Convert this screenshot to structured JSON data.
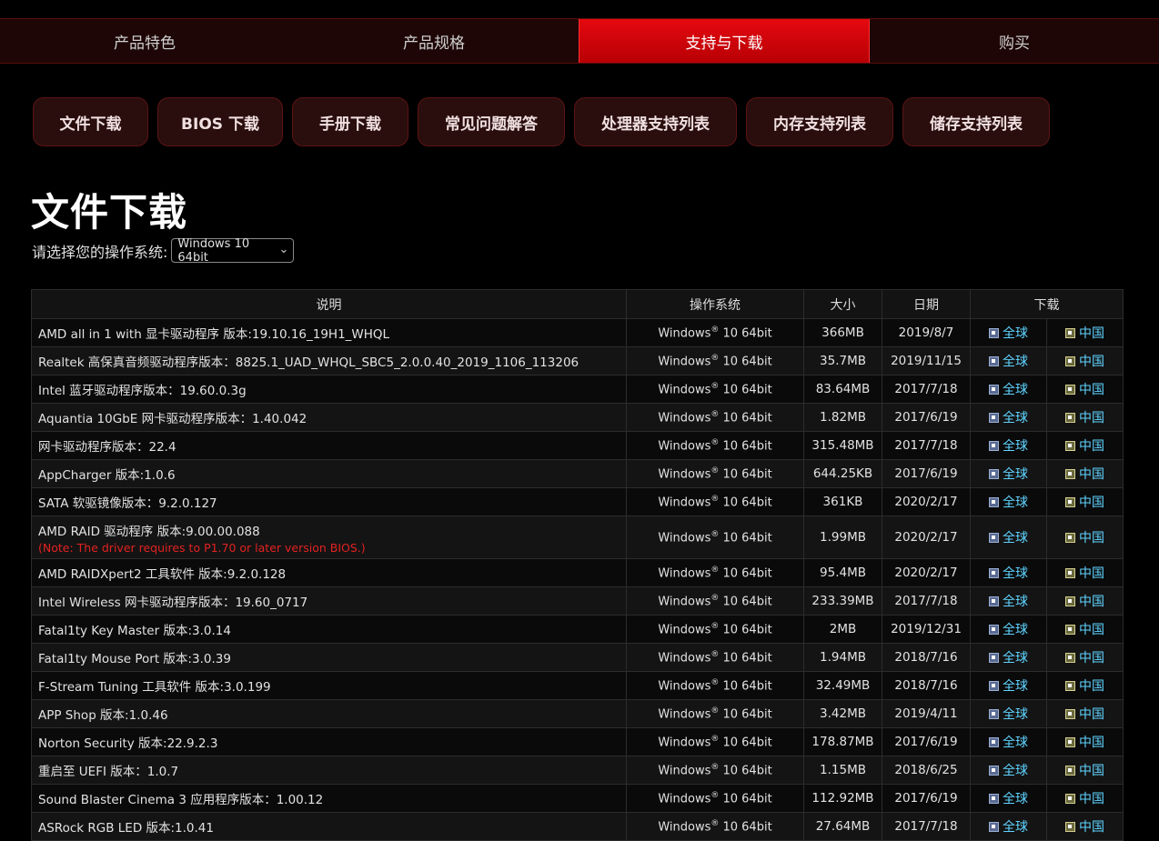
{
  "top_nav": [
    "产品特色",
    "产品规格",
    "支持与下载",
    "购买"
  ],
  "top_nav_active": 2,
  "sub_nav": [
    "文件下载",
    "BIOS 下载",
    "手册下载",
    "常见问题解答",
    "处理器支持列表",
    "内存支持列表",
    "储存支持列表"
  ],
  "page_title": "文件下载",
  "os_label": "请选择您的操作系统:",
  "os_selected": "Windows 10 64bit",
  "table": {
    "headers": [
      "说明",
      "操作系统",
      "大小",
      "日期",
      "下载"
    ],
    "link_global": "全球",
    "link_china": "中国",
    "os_prefix": "Windows",
    "os_reg": "®",
    "os_suffix": "10 64bit",
    "rows": [
      {
        "desc": "AMD all in 1 with 显卡驱动程序 版本:19.10.16_19H1_WHQL",
        "note": "",
        "size": "366MB",
        "date": "2019/8/7"
      },
      {
        "desc": "Realtek 高保真音频驱动程序版本：8825.1_UAD_WHQL_SBC5_2.0.0.40_2019_1106_113206",
        "note": "",
        "size": "35.7MB",
        "date": "2019/11/15"
      },
      {
        "desc": "Intel 蓝牙驱动程序版本：19.60.0.3g",
        "note": "",
        "size": "83.64MB",
        "date": "2017/7/18"
      },
      {
        "desc": "Aquantia 10GbE 网卡驱动程序版本：1.40.042",
        "note": "",
        "size": "1.82MB",
        "date": "2017/6/19"
      },
      {
        "desc": "网卡驱动程序版本：22.4",
        "note": "",
        "size": "315.48MB",
        "date": "2017/7/18"
      },
      {
        "desc": "AppCharger 版本:1.0.6",
        "note": "",
        "size": "644.25KB",
        "date": "2017/6/19"
      },
      {
        "desc": "SATA 软驱镜像版本：9.2.0.127",
        "note": "",
        "size": "361KB",
        "date": "2020/2/17"
      },
      {
        "desc": "AMD RAID 驱动程序 版本:9.00.00.088",
        "note": "(Note: The driver requires to P1.70 or later version BIOS.)",
        "size": "1.99MB",
        "date": "2020/2/17"
      },
      {
        "desc": "AMD RAIDXpert2 工具软件 版本:9.2.0.128",
        "note": "",
        "size": "95.4MB",
        "date": "2020/2/17"
      },
      {
        "desc": "Intel Wireless 网卡驱动程序版本：19.60_0717",
        "note": "",
        "size": "233.39MB",
        "date": "2017/7/18"
      },
      {
        "desc": "Fatal1ty Key Master 版本:3.0.14",
        "note": "",
        "size": "2MB",
        "date": "2019/12/31"
      },
      {
        "desc": "Fatal1ty Mouse Port 版本:3.0.39",
        "note": "",
        "size": "1.94MB",
        "date": "2018/7/16"
      },
      {
        "desc": "F-Stream Tuning 工具软件 版本:3.0.199",
        "note": "",
        "size": "32.49MB",
        "date": "2018/7/16"
      },
      {
        "desc": "APP Shop 版本:1.0.46",
        "note": "",
        "size": "3.42MB",
        "date": "2019/4/11"
      },
      {
        "desc": "Norton Security 版本:22.9.2.3",
        "note": "",
        "size": "178.87MB",
        "date": "2017/6/19"
      },
      {
        "desc": "重启至 UEFI 版本：1.0.7",
        "note": "",
        "size": "1.15MB",
        "date": "2018/6/25"
      },
      {
        "desc": "Sound Blaster Cinema 3 应用程序版本：1.00.12",
        "note": "",
        "size": "112.92MB",
        "date": "2017/6/19"
      },
      {
        "desc": "ASRock RGB LED 版本:1.0.41",
        "note": "",
        "size": "27.64MB",
        "date": "2017/7/18"
      }
    ]
  },
  "colors": {
    "accent": "#e4090f",
    "link": "#5fd3ff",
    "note": "#e32121"
  }
}
